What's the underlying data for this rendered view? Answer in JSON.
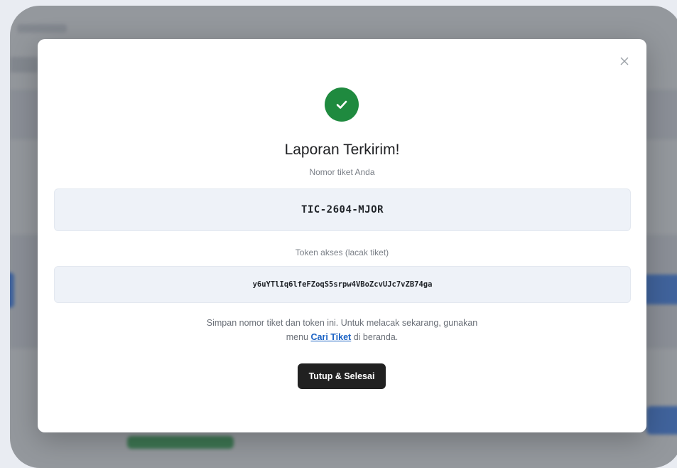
{
  "background": {
    "accent_blue": "#3b82f6",
    "accent_green": "#34a853"
  },
  "modal": {
    "close_icon": "close-icon",
    "success_icon": "check-icon",
    "success_color": "#1f8a3f",
    "title": "Laporan Terkirim!",
    "ticket_label": "Nomor tiket Anda",
    "ticket_number": "TIC-2604-MJOR",
    "token_label": "Token akses (lacak tiket)",
    "token_value": "y6uYTlIq6lfeFZoqS5srpw4VBoZcvUJc7vZB74ga",
    "note_part1": "Simpan nomor tiket dan token ini. Untuk melacak sekarang, gunakan",
    "note_part2_prefix": "menu ",
    "note_link": "Cari Tiket",
    "note_part2_suffix": " di beranda.",
    "done_button": "Tutup & Selesai"
  }
}
